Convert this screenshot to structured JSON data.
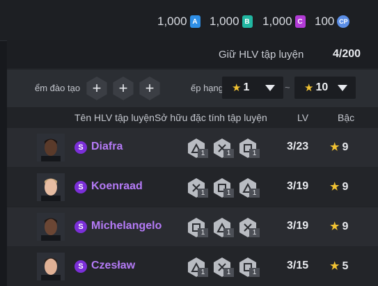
{
  "currencies": [
    {
      "value": "1,000",
      "badge": "A",
      "color": "#2f8fe6"
    },
    {
      "value": "1,000",
      "badge": "B",
      "color": "#21b7a2"
    },
    {
      "value": "1,000",
      "badge": "C",
      "color": "#b23bd6"
    },
    {
      "value": "100",
      "badge": "CP",
      "color": "#5b8ee6"
    }
  ],
  "count": {
    "label": "Giữ HLV tập luyện",
    "value": "4/200"
  },
  "filters": {
    "training_label": "ểm đào tạo",
    "slot_symbol": "+",
    "sort_label": "ếp hạng",
    "separator": "~",
    "from": "1",
    "to": "10"
  },
  "columns": {
    "name": "Tên HLV tập luyện",
    "traits": "Sở hữu đặc tính tập luyện",
    "lv": "LV",
    "rank": "Bậc"
  },
  "coaches": [
    {
      "badge": "S",
      "name": "Diafra",
      "lv": "3/23",
      "rank": "9",
      "skin": "#5a3a2a",
      "hair": "#1a1210",
      "traits": [
        {
          "icon": "trait-hex-icon",
          "n": "1"
        },
        {
          "icon": "trait-hex-icon",
          "n": "1"
        },
        {
          "icon": "trait-hex-icon",
          "n": "1"
        }
      ]
    },
    {
      "badge": "S",
      "name": "Koenraad",
      "lv": "3/19",
      "rank": "9",
      "skin": "#e6bca2",
      "hair": "#c7a57a",
      "traits": [
        {
          "icon": "trait-hex-icon",
          "n": "1"
        },
        {
          "icon": "trait-hex-icon",
          "n": "1"
        },
        {
          "icon": "trait-hex-icon",
          "n": "1"
        }
      ]
    },
    {
      "badge": "S",
      "name": "Michelangelo",
      "lv": "3/19",
      "rank": "9",
      "skin": "#6b4634",
      "hair": "#1f1612",
      "traits": [
        {
          "icon": "trait-hex-icon",
          "n": "1"
        },
        {
          "icon": "trait-hex-icon",
          "n": "1"
        },
        {
          "icon": "trait-hex-icon",
          "n": "1"
        }
      ]
    },
    {
      "badge": "S",
      "name": "Czesław",
      "lv": "3/15",
      "rank": "5",
      "skin": "#e0b196",
      "hair": "#2c211b",
      "traits": [
        {
          "icon": "trait-hex-icon",
          "n": "1"
        },
        {
          "icon": "trait-hex-icon",
          "n": "1"
        },
        {
          "icon": "trait-hex-icon",
          "n": "1"
        }
      ]
    }
  ]
}
